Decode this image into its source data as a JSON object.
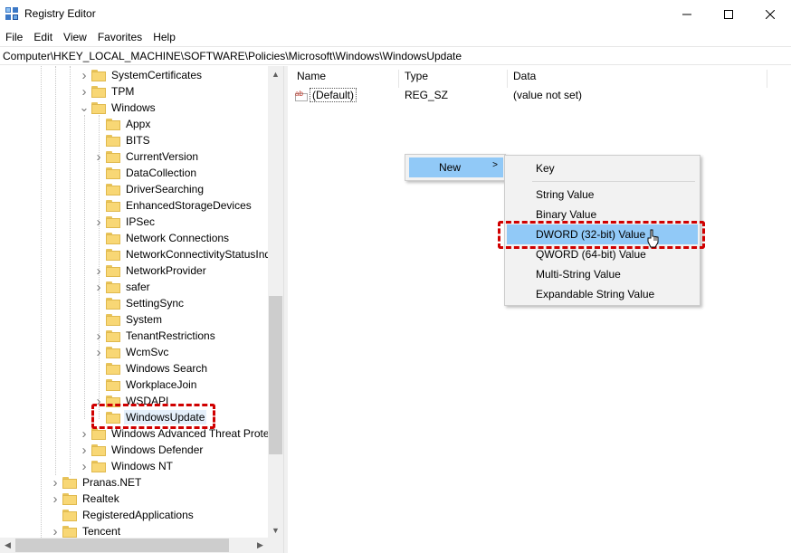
{
  "window": {
    "title": "Registry Editor",
    "minimize_glyph": "—",
    "maximize_glyph": "☐",
    "close_glyph": "✕"
  },
  "menu": [
    "File",
    "Edit",
    "View",
    "Favorites",
    "Help"
  ],
  "address": "Computer\\HKEY_LOCAL_MACHINE\\SOFTWARE\\Policies\\Microsoft\\Windows\\WindowsUpdate",
  "tree": {
    "items": [
      {
        "label": "SystemCertificates",
        "level": 1,
        "expandable": true
      },
      {
        "label": "TPM",
        "level": 1,
        "expandable": true
      },
      {
        "label": "Windows",
        "level": 1,
        "expandable": true,
        "expanded": true
      },
      {
        "label": "Appx",
        "level": 2,
        "expandable": false
      },
      {
        "label": "BITS",
        "level": 2,
        "expandable": false
      },
      {
        "label": "CurrentVersion",
        "level": 2,
        "expandable": true
      },
      {
        "label": "DataCollection",
        "level": 2,
        "expandable": false
      },
      {
        "label": "DriverSearching",
        "level": 2,
        "expandable": false
      },
      {
        "label": "EnhancedStorageDevices",
        "level": 2,
        "expandable": false
      },
      {
        "label": "IPSec",
        "level": 2,
        "expandable": true
      },
      {
        "label": "Network Connections",
        "level": 2,
        "expandable": false
      },
      {
        "label": "NetworkConnectivityStatusInd",
        "level": 2,
        "expandable": false
      },
      {
        "label": "NetworkProvider",
        "level": 2,
        "expandable": true
      },
      {
        "label": "safer",
        "level": 2,
        "expandable": true
      },
      {
        "label": "SettingSync",
        "level": 2,
        "expandable": false
      },
      {
        "label": "System",
        "level": 2,
        "expandable": false
      },
      {
        "label": "TenantRestrictions",
        "level": 2,
        "expandable": true
      },
      {
        "label": "WcmSvc",
        "level": 2,
        "expandable": true
      },
      {
        "label": "Windows Search",
        "level": 2,
        "expandable": false
      },
      {
        "label": "WorkplaceJoin",
        "level": 2,
        "expandable": false
      },
      {
        "label": "WSDAPI",
        "level": 2,
        "expandable": true
      },
      {
        "label": "WindowsUpdate",
        "level": 2,
        "expandable": false,
        "selected": true
      },
      {
        "label": "Windows Advanced Threat Protec",
        "level": 1,
        "expandable": true
      },
      {
        "label": "Windows Defender",
        "level": 1,
        "expandable": true
      },
      {
        "label": "Windows NT",
        "level": 1,
        "expandable": true
      },
      {
        "label": "Pranas.NET",
        "level": 0,
        "expandable": true
      },
      {
        "label": "Realtek",
        "level": 0,
        "expandable": true
      },
      {
        "label": "RegisteredApplications",
        "level": 0,
        "expandable": false
      },
      {
        "label": "Tencent",
        "level": 0,
        "expandable": true
      }
    ]
  },
  "list": {
    "columns": [
      "Name",
      "Type",
      "Data"
    ],
    "rows": [
      {
        "name": "(Default)",
        "type": "REG_SZ",
        "data": "(value not set)",
        "icon": "string-value-icon"
      }
    ]
  },
  "context_menu": {
    "new_label": "New",
    "submenu_arrow": ">",
    "submenu": {
      "key": "Key",
      "string_value": "String Value",
      "binary_value": "Binary Value",
      "dword_value": "DWORD (32-bit) Value",
      "qword_value": "QWORD (64-bit) Value",
      "multi_string_value": "Multi-String Value",
      "expandable_string_value": "Expandable String Value"
    }
  },
  "colors": {
    "menu_highlight": "#91c9f7",
    "annotation_red": "#d00000",
    "folder_yellow": "#f8d775"
  }
}
